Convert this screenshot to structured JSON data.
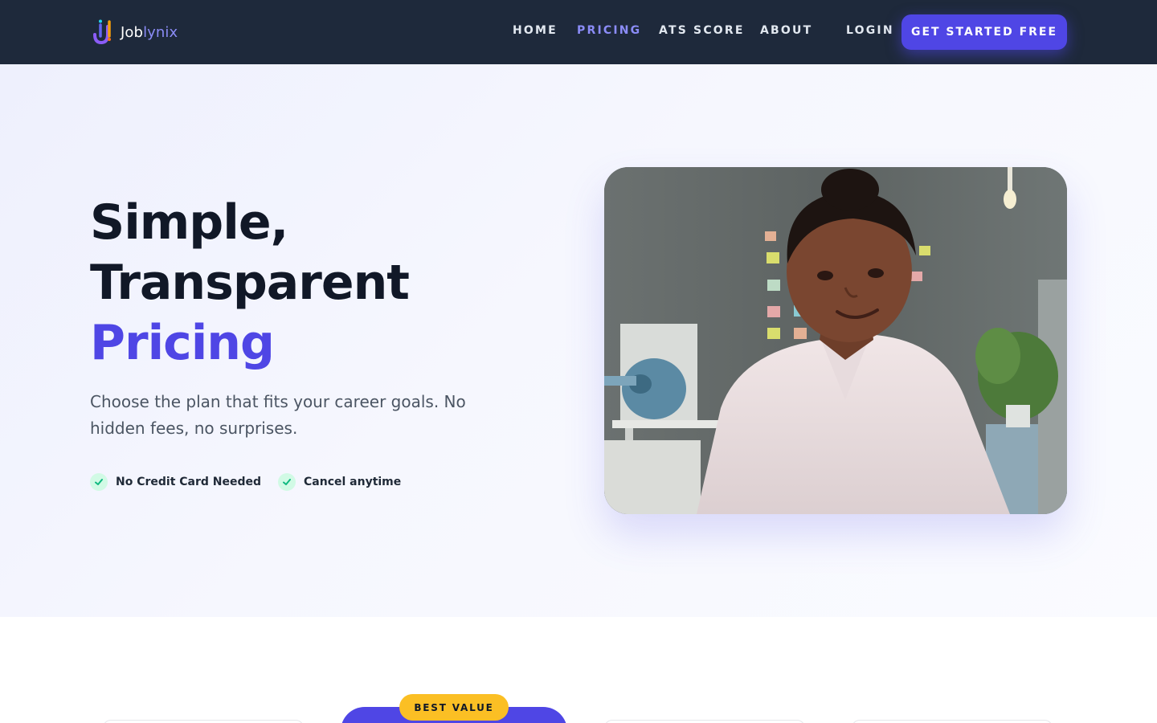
{
  "nav": {
    "logo": {
      "prefix": "Job",
      "accent": "lynix"
    },
    "links": [
      {
        "label": "HOME",
        "active": false
      },
      {
        "label": "PRICING",
        "active": true
      },
      {
        "label": "ATS SCORE",
        "active": false
      },
      {
        "label": "ABOUT",
        "active": false
      }
    ],
    "login_label": "LOGIN",
    "cta_label": "GET STARTED FREE"
  },
  "hero": {
    "headline": {
      "line1": "Simple,",
      "line2": "Transparent",
      "accent": "Pricing"
    },
    "subtext": "Choose the plan that fits your career goals. No hidden fees, no surprises.",
    "features": [
      "No Credit Card Needed",
      "Cancel anytime"
    ]
  },
  "pricing": {
    "badge": "BEST VALUE"
  },
  "colors": {
    "nav_bg": "#1e293b",
    "accent": "#4f46e5",
    "active_link": "#8b8cf7",
    "badge": "#fbbf24",
    "check_bg": "#d1fae5",
    "check": "#10b981"
  }
}
